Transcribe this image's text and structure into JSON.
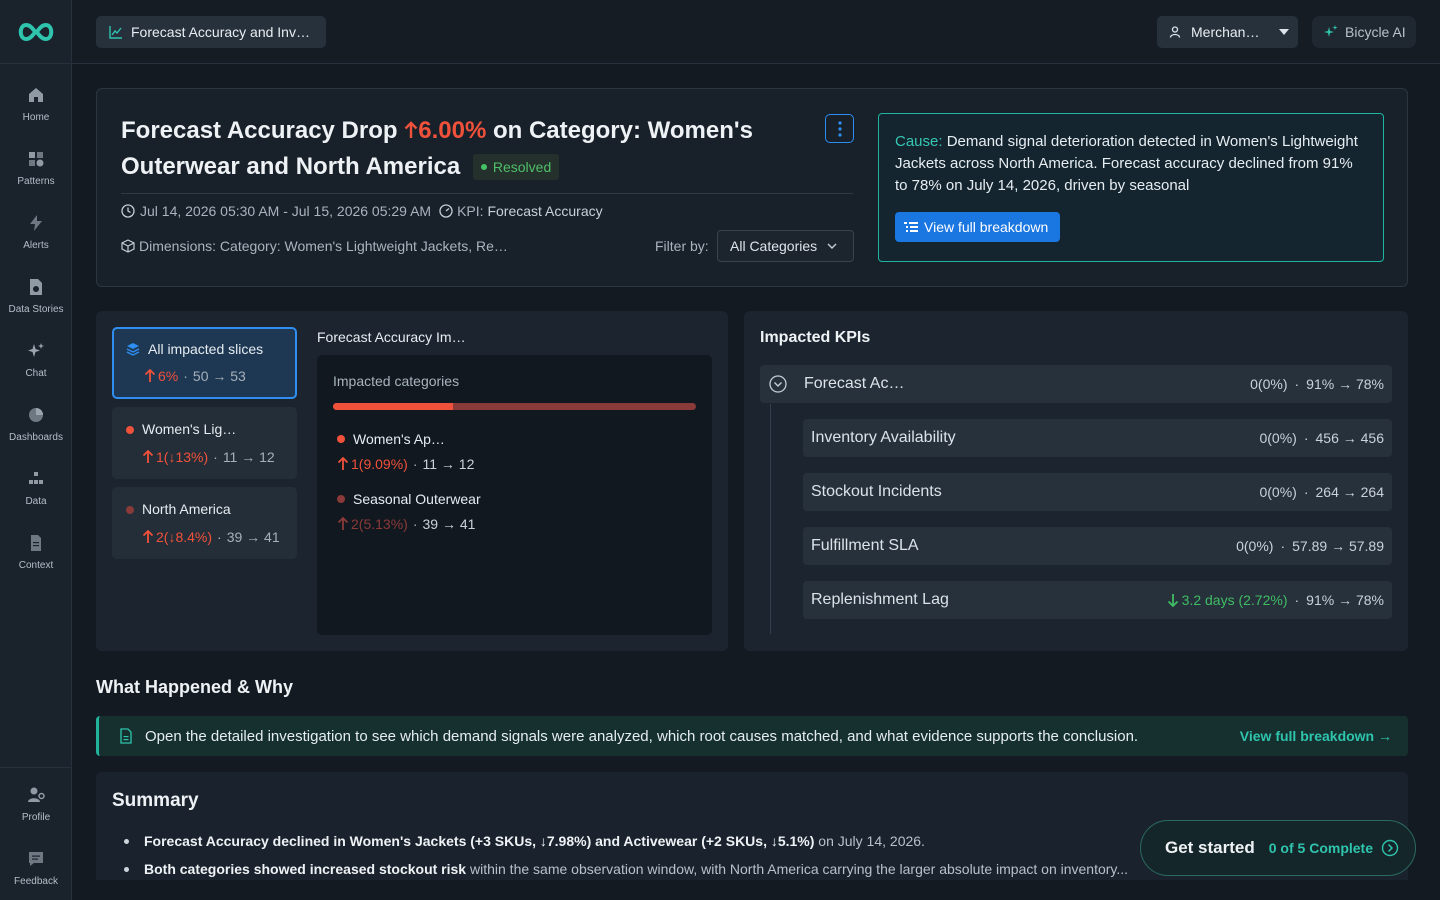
{
  "app": {
    "brand_color": "#2ec4ae",
    "accent": "#2d8ff3",
    "alert_red": "#f0513a"
  },
  "sidebar": {
    "items": [
      {
        "label": "Home",
        "icon": "home-icon"
      },
      {
        "label": "Patterns",
        "icon": "patterns-icon"
      },
      {
        "label": "Alerts",
        "icon": "bolt-icon"
      },
      {
        "label": "Data Stories",
        "icon": "data-stories-icon"
      },
      {
        "label": "Chat",
        "icon": "sparkle-icon"
      },
      {
        "label": "Dashboards",
        "icon": "pie-chart-icon"
      },
      {
        "label": "Data",
        "icon": "data-icon"
      },
      {
        "label": "Context",
        "icon": "document-icon"
      }
    ],
    "bottom": [
      {
        "label": "Profile",
        "icon": "user-gear-icon"
      },
      {
        "label": "Feedback",
        "icon": "chat-bubble-icon"
      }
    ]
  },
  "topbar": {
    "tab_title": "Forecast Accuracy and Inventory Availability",
    "role": "Merchandising",
    "assistant": "Bicycle AI"
  },
  "header": {
    "title_prefix": "Forecast Accuracy Drop",
    "title_change": "6.00%",
    "title_suffix": "on Category: Women's Outerwear and North America",
    "status": "Resolved",
    "time_range": "Jul 14, 2026 05:30 AM - Jul 15, 2026 05:29 AM",
    "kpi_label": "KPI:",
    "kpi_value": "Forecast Accuracy",
    "dimensions": "Dimensions: Category: Women's Lightweight Jackets, Region: North America",
    "filter_label": "Filter by:",
    "filter_value": "All Categories",
    "cause_label": "Cause:",
    "cause_text": "Demand signal deterioration detected in Women's Lightweight Jackets across North America. Forecast accuracy declined from 91% to 78% on July 14, 2026, driven by seasonal",
    "cause_button": "View full breakdown"
  },
  "slices": {
    "items": [
      {
        "title": "All impacted slices",
        "change": "6%",
        "sep": "·",
        "range": "50 → 53"
      },
      {
        "title": "Women's Lightweight Jackets",
        "change": "1(↓13%)",
        "sep": "·",
        "range": "11 → 12",
        "dot": "#f0513a"
      },
      {
        "title": "North America",
        "change": "2(↓8.4%)",
        "sep": "·",
        "range": "39 → 41",
        "dot": "#8a3a38"
      }
    ],
    "panel_title": "Forecast Accuracy Impacted categories",
    "impact_subtitle": "Impacted categories",
    "bar_share": 0.33,
    "categories": [
      {
        "name": "Women's Apparel",
        "change": "1(9.09%)",
        "sep": "·",
        "range": "11 → 12",
        "color": "#f0513a"
      },
      {
        "name": "Seasonal Outerwear",
        "change": "2(5.13%)",
        "sep": "·",
        "range": "39 → 41",
        "color": "#8a3a38"
      }
    ]
  },
  "kpis": {
    "title": "Impacted KPIs",
    "items": [
      {
        "name": "Forecast Accuracy",
        "change": "0(0%)",
        "sep": "·",
        "range": "91% → 78%"
      },
      {
        "name": "Inventory Availability",
        "change": "0(0%)",
        "sep": "·",
        "range": "456 → 456"
      },
      {
        "name": "Stockout Incidents",
        "change": "0(0%)",
        "sep": "·",
        "range": "264 → 264"
      },
      {
        "name": "Fulfillment SLA",
        "change": "0(0%)",
        "sep": "·",
        "range": "57.89 → 57.89"
      },
      {
        "name": "Replenishment Lag",
        "change": "3.2 days (2.72%)",
        "sep": "·",
        "range": "91% → 78%"
      }
    ]
  },
  "what_happened": {
    "title": "What Happened & Why",
    "banner": "Open the detailed investigation to see which demand signals were analyzed, which root causes matched, and what evidence supports the conclusion.",
    "link": "View full breakdown →"
  },
  "summary": {
    "title": "Summary",
    "items": [
      {
        "bold": "Forecast Accuracy declined in Women's Jackets (+3 SKUs, ↓7.98%) and Activewear (+2 SKUs, ↓5.1%)",
        "rest": " on July 14, 2026."
      },
      {
        "bold": "Both categories showed increased stockout risk",
        "rest": " within the same observation window, with North America carrying the larger absolute impact on inventory..."
      }
    ]
  },
  "get_started": {
    "title": "Get started",
    "progress": "0 of 5 Complete"
  }
}
